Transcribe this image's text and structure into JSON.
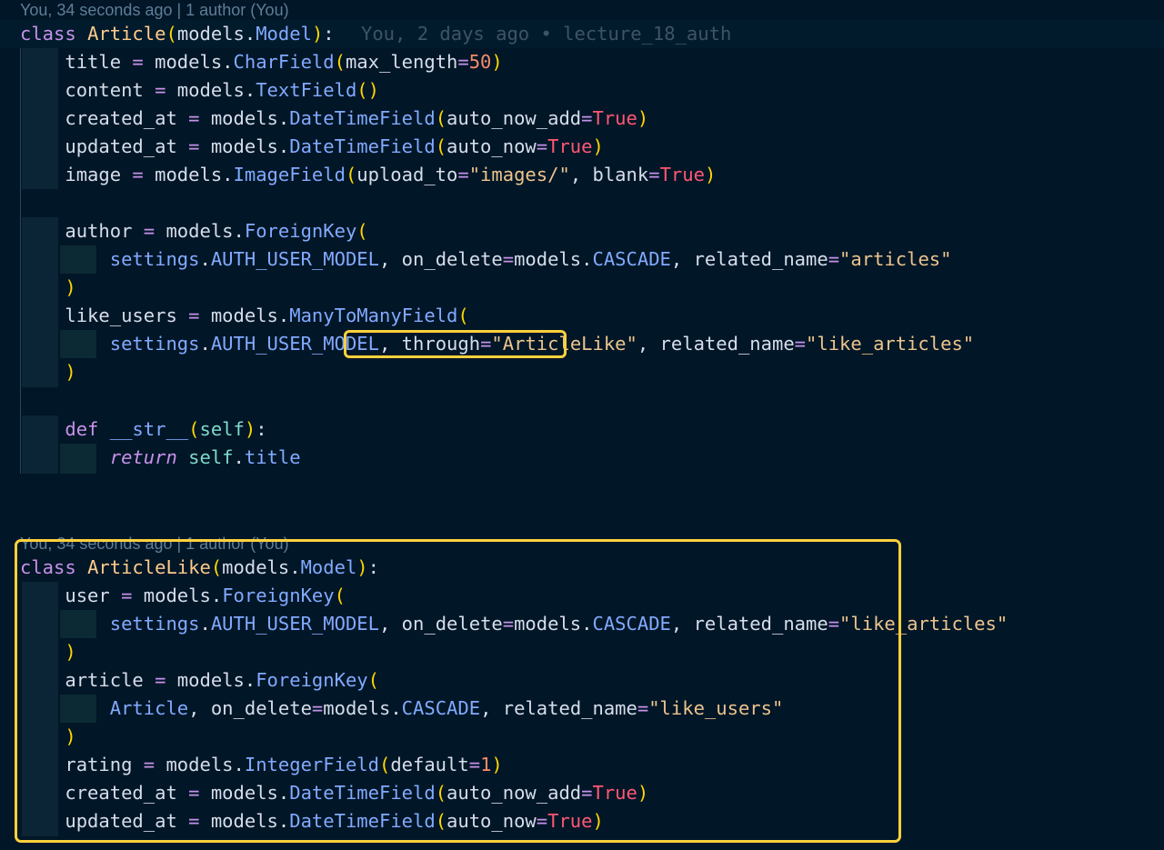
{
  "editor": {
    "codelens": [
      "You, 34 seconds ago | 1 author (You)",
      "You, 34 seconds ago | 1 author (You)"
    ],
    "inline_blame": "You, 2 days ago • lecture_18_auth",
    "lines": [
      "class Article(models.Model):",
      "    title = models.CharField(max_length=50)",
      "    content = models.TextField()",
      "    created_at = models.DateTimeField(auto_now_add=True)",
      "    updated_at = models.DateTimeField(auto_now=True)",
      "    image = models.ImageField(upload_to=\"images/\", blank=True)",
      "",
      "    author = models.ForeignKey(",
      "        settings.AUTH_USER_MODEL, on_delete=models.CASCADE, related_name=\"articles\"",
      "    )",
      "    like_users = models.ManyToManyField(",
      "        settings.AUTH_USER_MODEL, through=\"ArticleLike\", related_name=\"like_articles\"",
      "    )",
      "",
      "    def __str__(self):",
      "        return self.title",
      "",
      "",
      "",
      "class ArticleLike(models.Model):",
      "    user = models.ForeignKey(",
      "        settings.AUTH_USER_MODEL, on_delete=models.CASCADE, related_name=\"like_articles\"",
      "    )",
      "    article = models.ForeignKey(",
      "        Article, on_delete=models.CASCADE, related_name=\"like_users\"",
      "    )",
      "    rating = models.IntegerField(default=1)",
      "    created_at = models.DateTimeField(auto_now_add=True)",
      "    updated_at = models.DateTimeField(auto_now=True)"
    ],
    "highlights": [
      "through=\"ArticleLike\",",
      "class ArticleLike(models.Model)"
    ]
  },
  "colors": {
    "background": "#011627",
    "keyword": "#c792ea",
    "class_name": "#ffcb8b",
    "function": "#82aaff",
    "string": "#ecc48d",
    "boolean": "#ff5874",
    "number": "#f78c6c",
    "highlight_box": "#fbd13c"
  }
}
